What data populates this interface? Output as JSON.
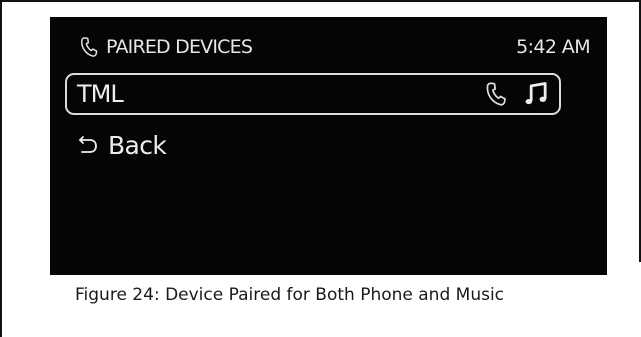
{
  "header": {
    "title": "PAIRED DEVICES",
    "time": "5:42 AM",
    "icon": "phone-icon"
  },
  "devices": [
    {
      "name": "TML",
      "icons": [
        "phone-icon",
        "music-note-icon"
      ]
    }
  ],
  "back": {
    "label": "Back",
    "icon": "back-arrow-icon"
  },
  "caption": "Figure 24: Device Paired for Both Phone and Music",
  "colors": {
    "screen_background": "#050505",
    "screen_text": "#e8e8e8",
    "page_background": "#ffffff"
  }
}
